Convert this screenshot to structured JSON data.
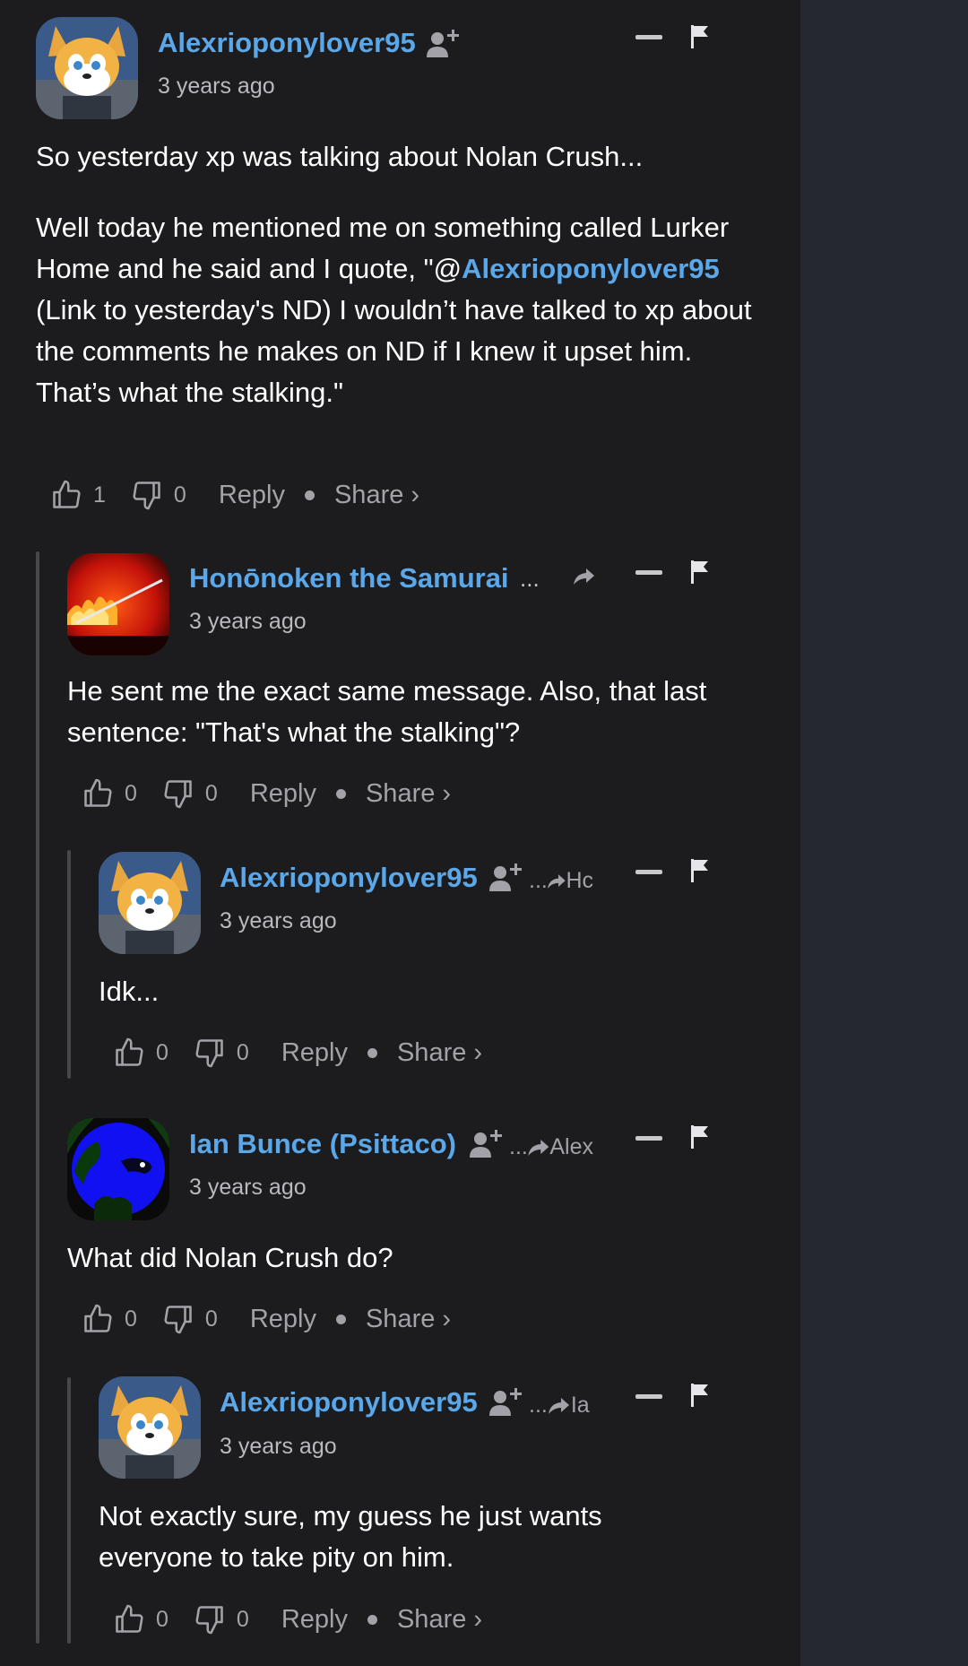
{
  "comments": [
    {
      "username": "Alexrioponylover95",
      "time": "3 years ago",
      "paragraphs": [
        "So yesterday xp was talking about Nolan Crush..."
      ],
      "p2_before": "Well today he mentioned me on something called Lurker Home and he said and I quote, \"@",
      "p2_mention": "Alexrioponylover95",
      "p2_after": " (Link to yesterday's ND) I wouldn’t have talked to xp about the comments he makes on ND if I knew it upset him. That’s what the stalking.\"",
      "likes": "1",
      "dislikes": "0",
      "reply_label": "Reply",
      "share_label": "Share ›"
    },
    {
      "username": "Honōnoken the Samurai",
      "username_more": "...",
      "time": "3 years ago",
      "text": "He sent me the exact same message. Also, that last sentence: \"That's what the stalking\"?",
      "likes": "0",
      "dislikes": "0",
      "reply_label": "Reply",
      "share_label": "Share ›"
    },
    {
      "username": "Alexrioponylover95",
      "reply_to_prefix": "...",
      "reply_to": "Hc",
      "time": "3 years ago",
      "text": "Idk...",
      "likes": "0",
      "dislikes": "0",
      "reply_label": "Reply",
      "share_label": "Share ›"
    },
    {
      "username": "Ian Bunce (Psittaco)",
      "reply_to_prefix": "...",
      "reply_to": "Alex",
      "time": "3 years ago",
      "text": "What did Nolan Crush do?",
      "likes": "0",
      "dislikes": "0",
      "reply_label": "Reply",
      "share_label": "Share ›"
    },
    {
      "username": "Alexrioponylover95",
      "reply_to_prefix": "...",
      "reply_to": "Ia",
      "time": "3 years ago",
      "text": "Not exactly sure, my guess he just wants everyone to take pity on him.",
      "likes": "0",
      "dislikes": "0",
      "reply_label": "Reply",
      "share_label": "Share ›"
    }
  ],
  "icons": {
    "like": "thumbs-up-icon",
    "dislike": "thumbs-down-icon",
    "collapse": "minus-icon",
    "flag": "flag-icon",
    "follow": "add-user-icon",
    "reply_to": "reply-arrow-icon"
  },
  "colors": {
    "background": "#1c1c1e",
    "side_panel": "#252831",
    "username": "#5aa8ea",
    "muted": "#a2a2a8",
    "thread_line": "#47474c"
  }
}
